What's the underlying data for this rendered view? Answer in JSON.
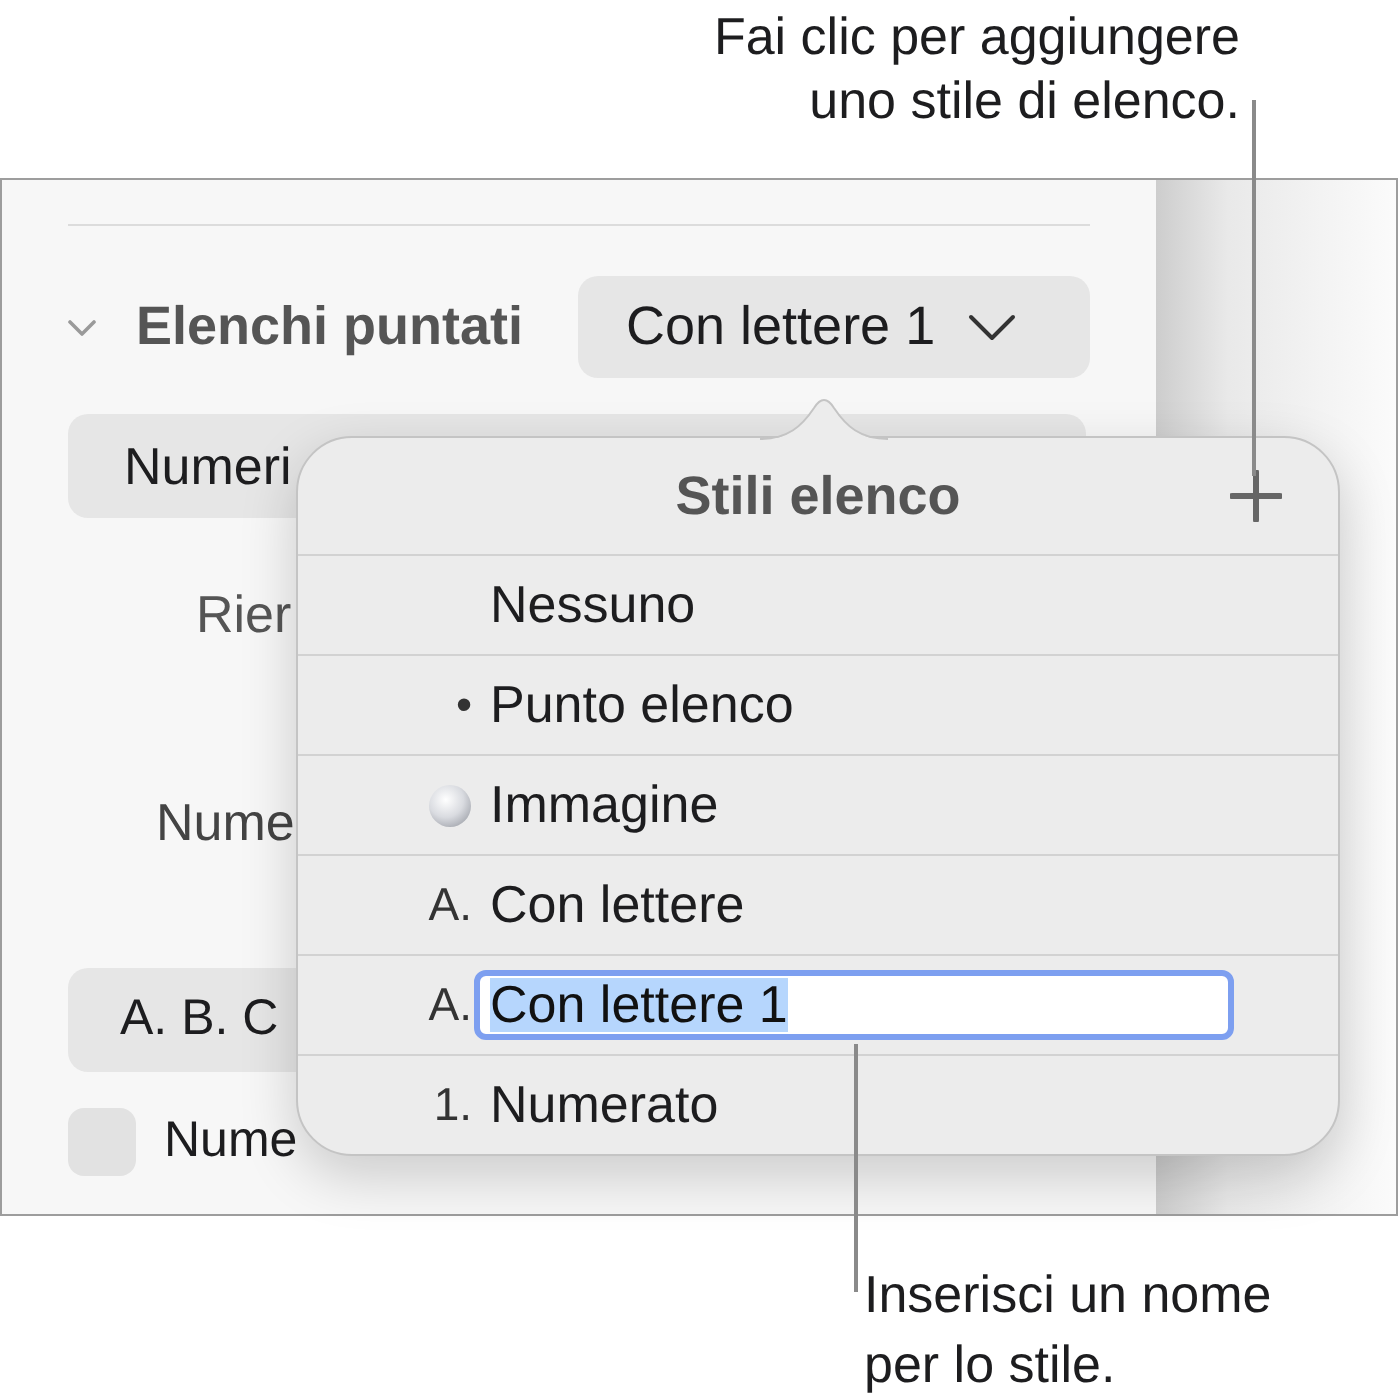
{
  "top_callout": {
    "text": "Fai clic per aggiungere uno stile di elenco."
  },
  "inspector": {
    "section_title": "Elenchi puntati",
    "expanded": true,
    "style_button": "Con lettere 1",
    "type_button": "Numeri",
    "indent_label": "Rier",
    "numbering_label": "Nume",
    "format_button": "A. B. C",
    "tiered_checkbox": {
      "label": "Nume",
      "checked": false
    }
  },
  "popover": {
    "title": "Stili elenco",
    "items": [
      {
        "kind": "plain",
        "label": "Nessuno",
        "editing": false
      },
      {
        "kind": "plain",
        "marker": "•",
        "label": "Punto elenco",
        "editing": false
      },
      {
        "kind": "image",
        "label": "Immagine",
        "editing": false
      },
      {
        "kind": "plain",
        "marker": "A.",
        "label": "Con lettere",
        "editing": false
      },
      {
        "kind": "plain",
        "marker": "A.",
        "label": "Con lettere 1",
        "editing": true
      },
      {
        "kind": "plain",
        "marker": "1.",
        "label": "Numerato",
        "editing": false
      }
    ]
  },
  "bottom_callout": {
    "text": "Inserisci un nome per lo stile."
  }
}
